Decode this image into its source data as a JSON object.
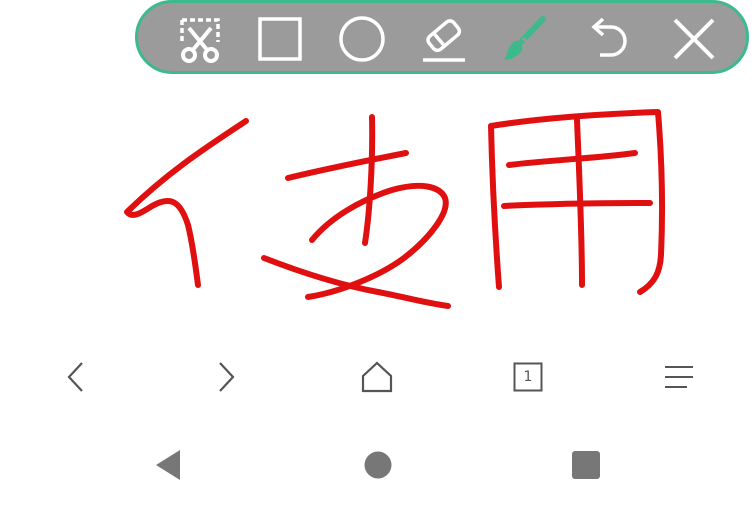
{
  "toolbar": {
    "border_color": "#3dba8c",
    "background_color": "#9b9b9b",
    "icon_color": "#ffffff",
    "active_tool_color": "#3dba8c",
    "tools": [
      "crop-scissors-icon",
      "rectangle-icon",
      "circle-icon",
      "eraser-icon",
      "brush-icon",
      "undo-icon",
      "close-icon"
    ],
    "active_tool": "brush-icon"
  },
  "canvas": {
    "handwriting_text": "使用",
    "stroke_color": "#e01010"
  },
  "browser_nav": {
    "tab_count": "1",
    "icons": [
      "back-icon",
      "forward-icon",
      "home-icon",
      "tabs-icon",
      "menu-icon"
    ]
  },
  "system_nav": {
    "icons": [
      "system-back-icon",
      "system-home-icon",
      "system-recents-icon"
    ],
    "icon_color": "#777777"
  }
}
